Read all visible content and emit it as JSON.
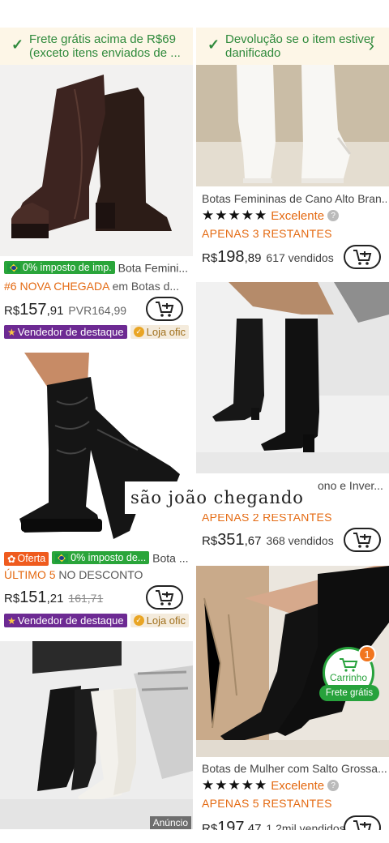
{
  "banner": {
    "left_text": "Frete grátis acima de R$69 (exceto itens enviados de ...",
    "right_text": "Devolução se o item estiver danificado"
  },
  "products": [
    {
      "title": "Bota Femini...",
      "tax_badge": "0% imposto de imp.",
      "rank_prefix": "#6 NOVA CHEGADA",
      "rank_suffix": "em Botas d...",
      "currency": "R$",
      "price_int": "157",
      "price_cents": ",91",
      "ref_price": "PVR164,99",
      "seller_badge": "Vendedor de destaque",
      "store_badge": "Loja ofic"
    },
    {
      "title": "Botas Femininas de Cano Alto Bran...",
      "rating": "Excelente",
      "stock": "APENAS 3 RESTANTES",
      "currency": "R$",
      "price_int": "198",
      "price_cents": ",89",
      "sold": "617 vendidos"
    },
    {
      "offer_badge": "Oferta",
      "tax_badge": "0% imposto de...",
      "title": "Bota ...",
      "promo_highlight": "ÚLTIMO 5",
      "promo_text": "NO DESCONTO",
      "currency": "R$",
      "price_int": "151",
      "price_cents": ",21",
      "old_price": "161,71",
      "seller_badge": "Vendedor de destaque",
      "store_badge": "Loja ofic"
    },
    {
      "title_partial": "ono e Inver...",
      "stock": "APENAS 2 RESTANTES",
      "currency": "R$",
      "price_int": "351",
      "price_cents": ",67",
      "sold": "368 vendidos"
    },
    {
      "ad_tag": "Anúncio"
    },
    {
      "title": "Botas de Mulher com Salto Grossa...",
      "rating": "Excelente",
      "stock": "APENAS 5 RESTANTES",
      "currency": "R$",
      "price_int": "197",
      "price_cents": ",47",
      "sold": "1,2mil vendidos"
    }
  ],
  "caption": "são joão chegando",
  "float_cart": {
    "label": "Carrinho",
    "count": "1",
    "free_shipping": "Frete grátis"
  },
  "colors": {
    "accent_green": "#2f8a3c",
    "accent_orange": "#e46a12",
    "seller_purple": "#6d2a93"
  }
}
